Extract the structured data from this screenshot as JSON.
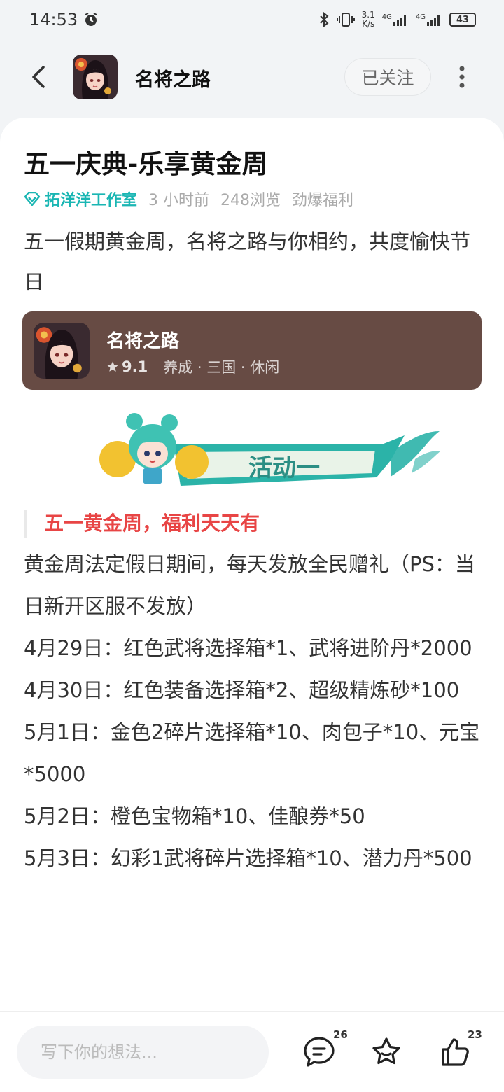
{
  "status_bar": {
    "time": "14:53",
    "net_speed_value": "3.1",
    "net_speed_unit": "K/s",
    "signal_label_1": "4G",
    "signal_label_2": "4G",
    "battery": "43"
  },
  "header": {
    "title": "名将之路",
    "follow_label": "已关注"
  },
  "post": {
    "title": "五一庆典-乐享黄金周",
    "author": "拓洋洋工作室",
    "time_ago": "3 小时前",
    "views": "248浏览",
    "tag": "劲爆福利",
    "intro": "五一假期黄金周，名将之路与你相约，共度愉快节日"
  },
  "game_card": {
    "name": "名将之路",
    "rating": "9.1",
    "genres": "养成 · 三国 · 休闲"
  },
  "banner": {
    "text": "活动一"
  },
  "section": {
    "title": "五一黄金周，福利天天有",
    "paragraphs": [
      "黄金周法定假日期间，每天发放全民赠礼（PS：当日新开区服不发放）",
      "4月29日：红色武将选择箱*1、武将进阶丹*2000",
      "4月30日：红色装备选择箱*2、超级精炼砂*100",
      "5月1日：金色2碎片选择箱*10、肉包子*10、元宝*5000",
      "5月2日：橙色宝物箱*10、佳酿券*50",
      "5月3日：幻彩1武将碎片选择箱*10、潜力丹*500"
    ]
  },
  "bottom_bar": {
    "input_placeholder": "写下你的想法...",
    "comment_count": "26",
    "like_count": "23"
  },
  "colors": {
    "accent_teal": "#1ab6b3",
    "section_red": "#e84545",
    "game_card_bg": "#674b44"
  }
}
